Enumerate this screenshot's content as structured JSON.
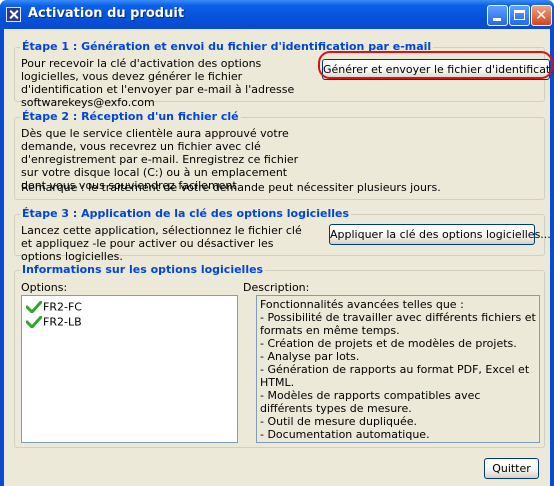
{
  "window": {
    "title": "Activation du produit"
  },
  "step1": {
    "heading": "Étape 1 : Génération et envoi du fichier d'identification par e-mail",
    "text": "Pour recevoir la clé d'activation des options logicielles, vous devez générer le fichier d'identification et l'envoyer par e-mail à l'adresse softwarekeys@exfo.com",
    "button": "Générer et envoyer le fichier d'identification..."
  },
  "step2": {
    "heading": "Étape 2 : Réception d'un fichier clé",
    "text": "Dès que le service clientèle aura approuvé votre demande, vous recevrez un fichier avec clé d'enregistrement par e-mail. Enregistrez ce fichier sur votre disque local (C:) ou à un emplacement dont vous vous souviendrez facilement.",
    "note": "Remarque : le traitement de votre demande peut nécessiter plusieurs jours."
  },
  "step3": {
    "heading": "Étape 3 : Application de la clé des options logicielles",
    "text": "Lancez cette application, sélectionnez le fichier clé et appliquez -le pour activer ou désactiver les options logicielles.",
    "button": "Appliquer la clé des options logicielles..."
  },
  "info": {
    "heading": "Informations sur les options logicielles",
    "options_label": "Options:",
    "description_label": "Description:",
    "options": [
      {
        "name": "FR2-FC",
        "icon": "green-check-icon"
      },
      {
        "name": "FR2-LB",
        "icon": "green-check-icon"
      }
    ],
    "description_lines": [
      "Fonctionnalités avancées telles que :",
      "- Possibilité de travailler avec différents fichiers et formats en même temps.",
      "- Création de projets et de modèles de projets.",
      "- Analyse par lots.",
      "- Génération de rapports au format PDF, Excel et HTML.",
      "- Modèles de rapports compatibles avec différents types de mesure.",
      "- Outil de mesure dupliquée.",
      "- Documentation automatique."
    ]
  },
  "footer": {
    "quit_button": "Quitter"
  },
  "colors": {
    "heading": "#0046d5",
    "highlight": "#e01010",
    "check": "#2ea82e"
  }
}
